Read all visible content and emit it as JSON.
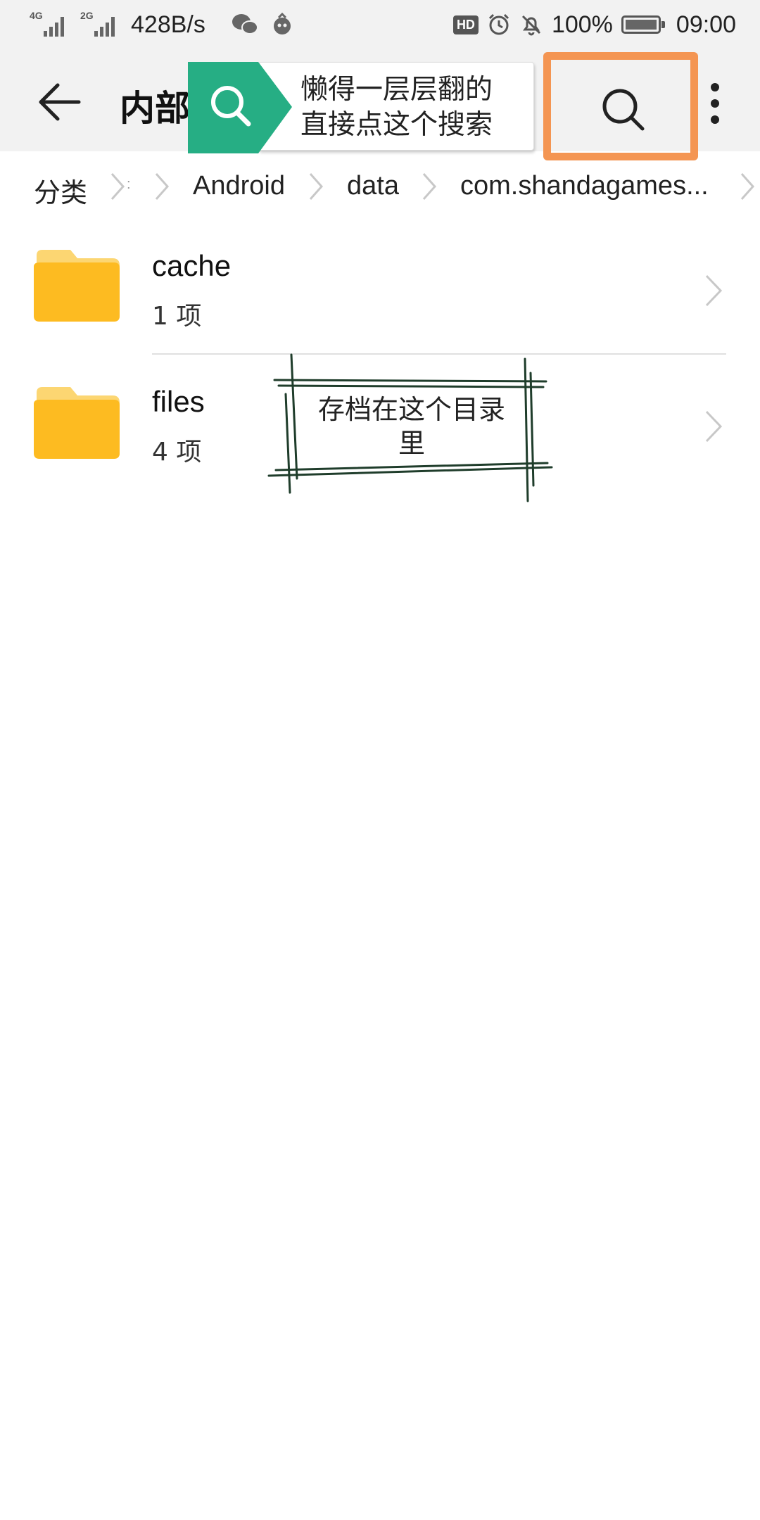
{
  "status_bar": {
    "signal1_label": "4G",
    "signal2_label": "2G",
    "net_speed": "428B/s",
    "hd_label": "HD",
    "battery_percent": "100%",
    "time": "09:00",
    "icons": [
      "wechat-icon",
      "app-notification-icon",
      "alarm-icon",
      "mute-bell-icon",
      "battery-charging-icon"
    ]
  },
  "app_bar": {
    "title": "内部",
    "back_icon": "arrow-left-icon",
    "search_icon": "search-icon",
    "more_icon": "more-vertical-icon",
    "highlight_color": "#f49552"
  },
  "tooltip": {
    "line1": "懒得一层层翻的",
    "line2": "直接点这个搜索",
    "icon_color": "#26ae84"
  },
  "breadcrumb": {
    "items": [
      "分类",
      "Android",
      "data",
      "com.shandagames..."
    ]
  },
  "files": [
    {
      "name": "cache",
      "count": "1 项"
    },
    {
      "name": "files",
      "count": "4 项"
    }
  ],
  "annotation": {
    "text": "存档在这个目录里"
  },
  "colors": {
    "folder": "#fdbb21",
    "folder_tab": "#fcd672",
    "bar_bg": "#f2f2f2"
  }
}
